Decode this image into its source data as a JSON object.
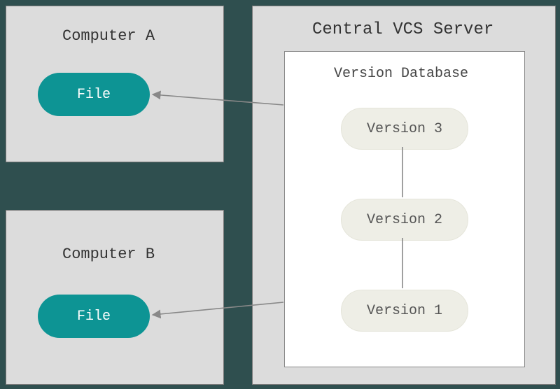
{
  "computer_a": {
    "title": "Computer A",
    "file_label": "File"
  },
  "computer_b": {
    "title": "Computer B",
    "file_label": "File"
  },
  "server": {
    "title": "Central VCS Server",
    "db_title": "Version Database",
    "versions": {
      "v3": "Version 3",
      "v2": "Version 2",
      "v1": "Version 1"
    }
  },
  "colors": {
    "file_pill": "#0d9494",
    "panel_bg": "#dcdcdc",
    "page_bg": "#2f4f4f"
  },
  "chart_data": {
    "type": "diagram",
    "nodes": [
      {
        "id": "compA",
        "label": "Computer A",
        "kind": "client",
        "children": [
          {
            "id": "fileA",
            "label": "File"
          }
        ]
      },
      {
        "id": "compB",
        "label": "Computer B",
        "kind": "client",
        "children": [
          {
            "id": "fileB",
            "label": "File"
          }
        ]
      },
      {
        "id": "server",
        "label": "Central VCS Server",
        "kind": "server",
        "children": [
          {
            "id": "db",
            "label": "Version Database",
            "children": [
              {
                "id": "v3",
                "label": "Version 3"
              },
              {
                "id": "v2",
                "label": "Version 2"
              },
              {
                "id": "v1",
                "label": "Version 1"
              }
            ]
          }
        ]
      }
    ],
    "edges": [
      {
        "from": "db",
        "to": "fileA",
        "style": "arrow"
      },
      {
        "from": "db",
        "to": "fileB",
        "style": "arrow"
      },
      {
        "from": "v3",
        "to": "v2",
        "style": "line"
      },
      {
        "from": "v2",
        "to": "v1",
        "style": "line"
      }
    ]
  }
}
